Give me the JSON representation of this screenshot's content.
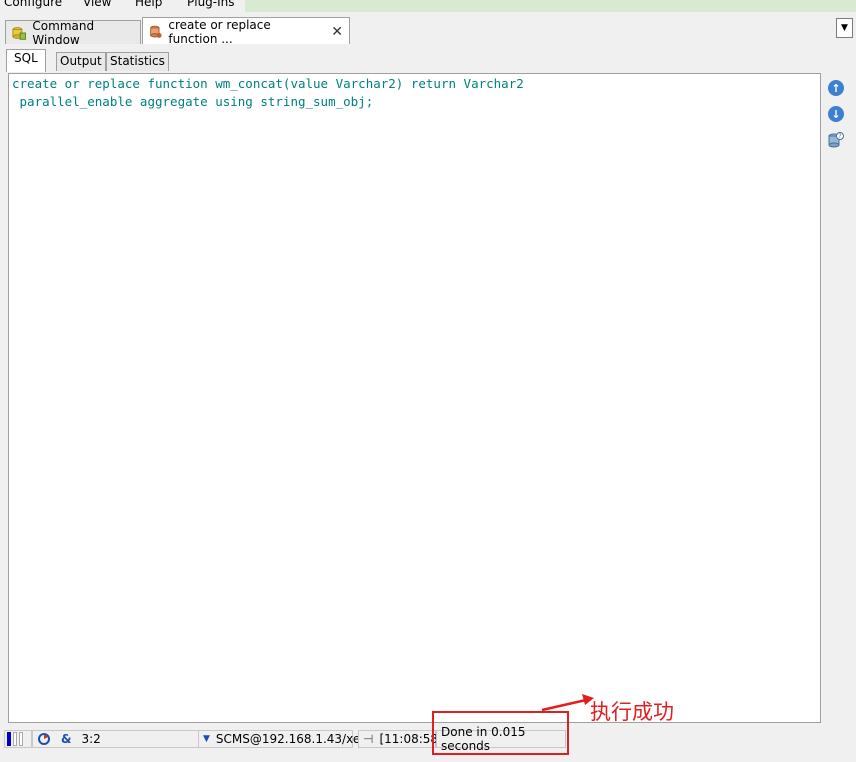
{
  "menu": {
    "items": [
      "Configure",
      "View",
      "Help",
      "Plug-Ins"
    ]
  },
  "doc_tabs": {
    "command_window": "Command Window",
    "active": "create or replace function ...",
    "close_symbol": "✕",
    "dropdown_symbol": "▼"
  },
  "sub_tabs": [
    "SQL",
    "Output",
    "Statistics"
  ],
  "editor": {
    "lines": [
      "create or replace function wm_concat(value Varchar2) return Varchar2",
      " parallel_enable aggregate using string_sum_obj;"
    ]
  },
  "side_buttons": [
    "up-arrow",
    "down-arrow",
    "database-info"
  ],
  "status": {
    "cursor": "3:2",
    "ampersand": "&",
    "connection": "SCMS@192.168.1.43/xe",
    "time": "[11:08:58",
    "message": "Done in 0.015 seconds"
  },
  "annotation": {
    "text": "执行成功",
    "color": "#e02020"
  }
}
